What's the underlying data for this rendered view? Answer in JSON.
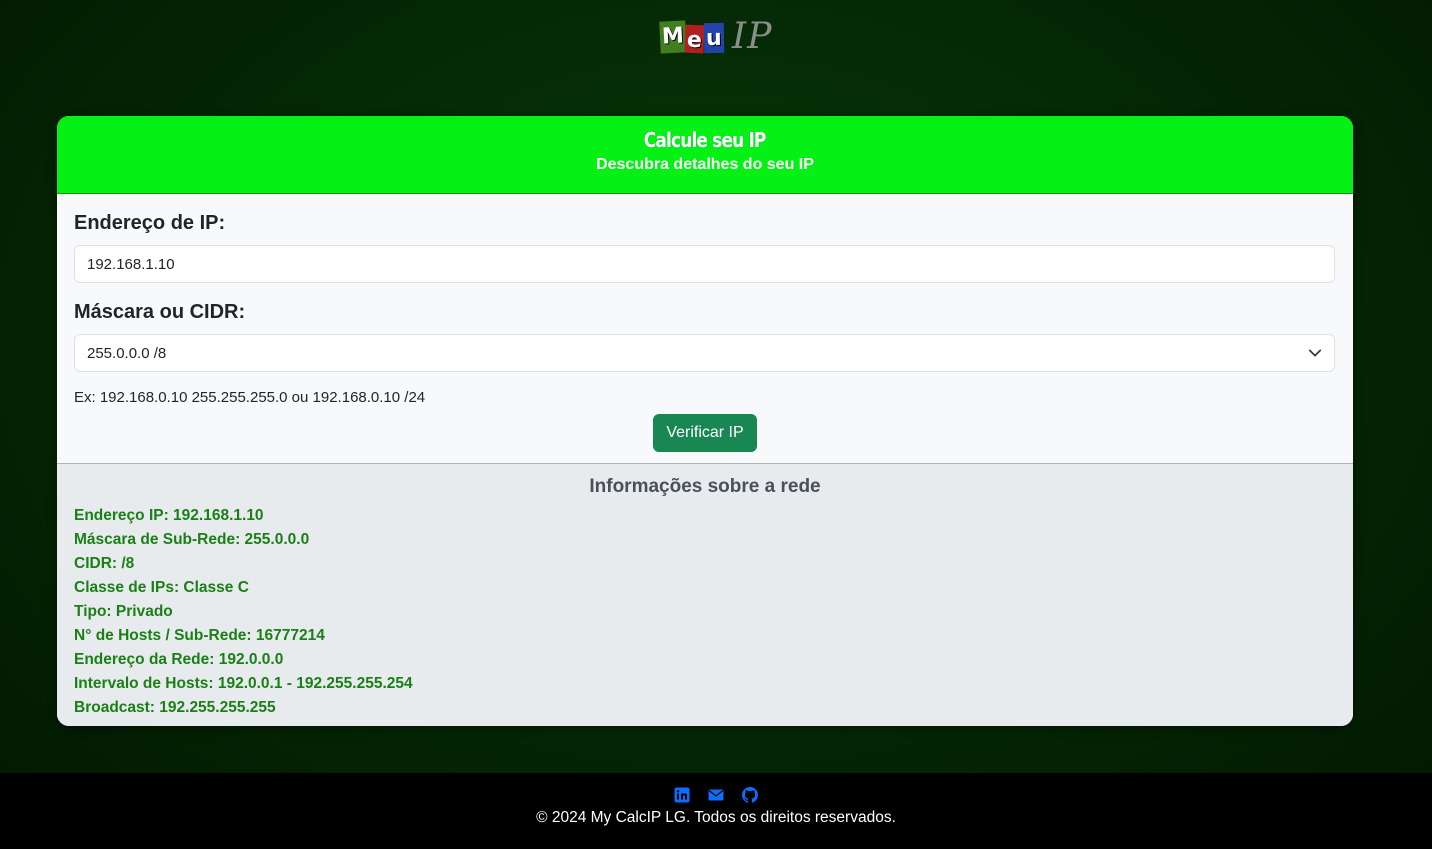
{
  "logo": {
    "meu_letters": [
      "M",
      "e",
      "u"
    ],
    "ip": "IP"
  },
  "header": {
    "title": "Calcule seu IP",
    "subtitle": "Descubra detalhes do seu IP"
  },
  "form": {
    "ip_label": "Endereço de IP:",
    "ip_value": "192.168.1.10",
    "mask_label": "Máscara ou CIDR:",
    "mask_selected": "255.0.0.0 /8",
    "hint": "Ex: 192.168.0.10 255.255.255.0 ou 192.168.0.10 /24",
    "button": "Verificar IP"
  },
  "info": {
    "title": "Informações sobre a rede",
    "lines": [
      "Endereço IP: 192.168.1.10",
      "Máscara de Sub-Rede: 255.0.0.0",
      "CIDR: /8",
      "Classe de IPs: Classe C",
      "Tipo: Privado",
      "N° de Hosts / Sub-Rede: 16777214",
      "Endereço da Rede: 192.0.0.0",
      "Intervalo de Hosts: 192.0.0.1 - 192.255.255.254",
      "Broadcast: 192.255.255.255"
    ]
  },
  "footer": {
    "icons": [
      "linkedin-icon",
      "envelope-icon",
      "github-icon"
    ],
    "copyright": "© 2024 My CalcIP LG. Todos os direitos reservados."
  },
  "colors": {
    "header": "#05f015",
    "button": "#198754",
    "info_text": "#1a7f16",
    "icon": "#0d6efd"
  }
}
